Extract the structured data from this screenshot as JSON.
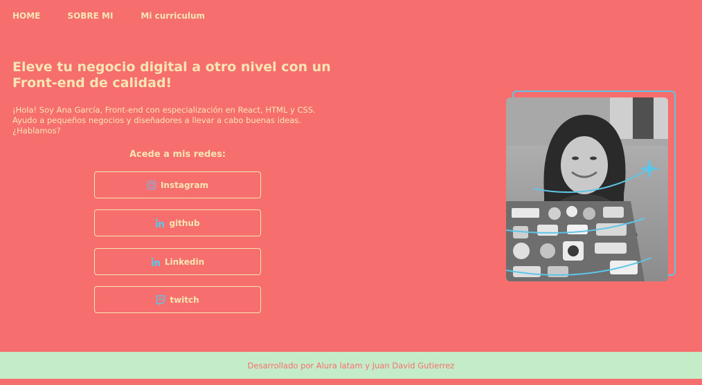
{
  "nav": {
    "home": "HOME",
    "about": "SOBRE MI",
    "cv": "Mi curriculum"
  },
  "hero": {
    "headline": "Eleve tu negocio digital a otro nivel con un Front-end de calidad!",
    "intro": "¡Hola! Soy Ana García, Front-end con especialización en React, HTML y CSS. Ayudo a pequeños negocios y diseñadores a llevar a cabo buenas ideas. ¿Hablamos?"
  },
  "social": {
    "title": "Acede a mis redes:",
    "buttons": [
      {
        "label": "Instagram",
        "icon": "instagram-icon"
      },
      {
        "label": "github",
        "icon": "linkedin-icon"
      },
      {
        "label": "Linkedin",
        "icon": "linkedin-icon"
      },
      {
        "label": "twitch",
        "icon": "twitch-icon"
      }
    ]
  },
  "footer": {
    "text": "Desarrollado por Alura latam y Juan David Gutierrez"
  },
  "colors": {
    "background": "#f76e6e",
    "text": "#f6e6b4",
    "accent": "#5ec5e8",
    "footer_bg": "#c5ecc8"
  }
}
